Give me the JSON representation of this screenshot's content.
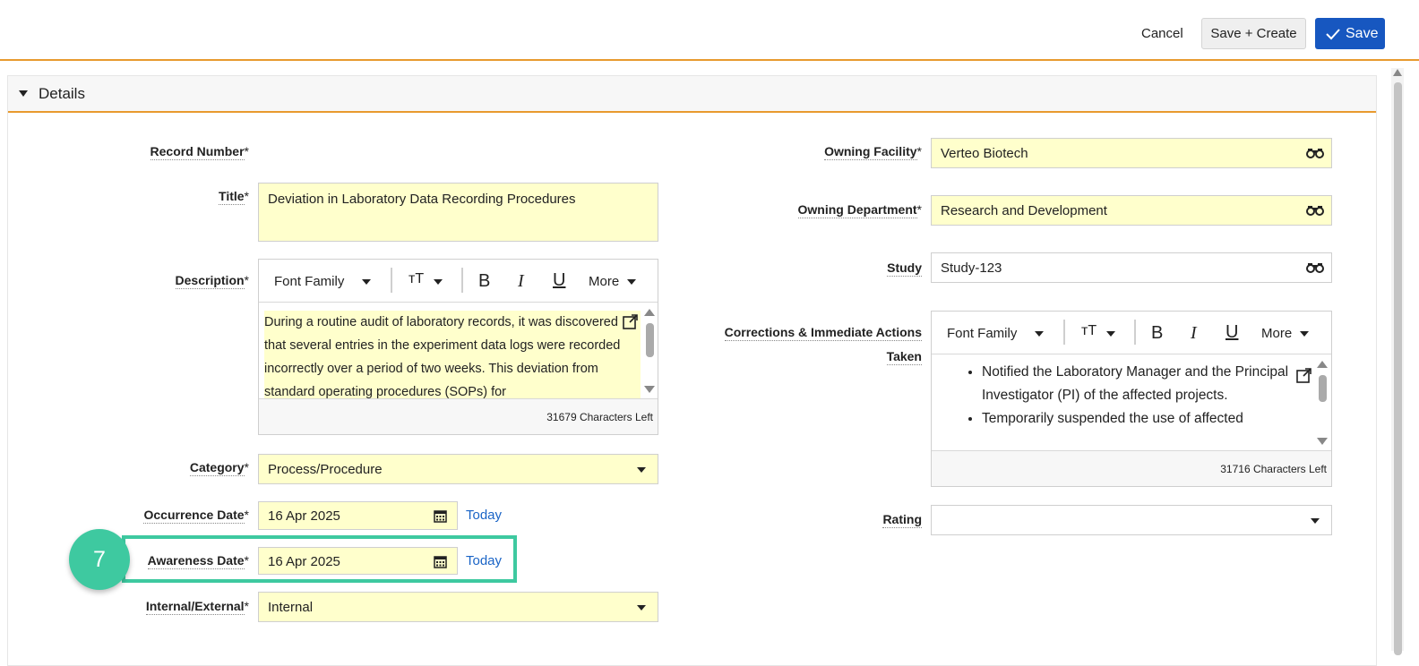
{
  "toolbar": {
    "cancel_label": "Cancel",
    "save_create_label": "Save + Create",
    "save_label": "Save"
  },
  "section": {
    "title": "Details"
  },
  "required_mark": "*",
  "left": {
    "record_number": {
      "label": "Record Number"
    },
    "title": {
      "label": "Title",
      "value": "Deviation in Laboratory Data Recording Procedures"
    },
    "description": {
      "label": "Description",
      "toolbar": {
        "font_family": "Font Family",
        "text_size": "тТ",
        "bold": "B",
        "italic": "I",
        "underline": "U",
        "more": "More"
      },
      "text": "During a routine audit of laboratory records, it was discovered that several entries in the experiment data logs were recorded incorrectly over a period of two weeks. This deviation from standard operating procedures (SOPs) for",
      "chars_left": "31679 Characters Left"
    },
    "category": {
      "label": "Category",
      "value": "Process/Procedure"
    },
    "occurrence_date": {
      "label": "Occurrence Date",
      "value": "16 Apr 2025",
      "today": "Today"
    },
    "awareness_date": {
      "label": "Awareness Date",
      "value": "16 Apr 2025",
      "today": "Today"
    },
    "internal_external": {
      "label": "Internal/External",
      "value": "Internal"
    }
  },
  "right": {
    "owning_facility": {
      "label": "Owning Facility",
      "value": "Verteo Biotech"
    },
    "owning_department": {
      "label": "Owning Department",
      "value": "Research and Development"
    },
    "study": {
      "label": "Study",
      "value": "Study-123"
    },
    "corrections": {
      "label_line1": "Corrections & Immediate Actions",
      "label_line2": "Taken",
      "toolbar": {
        "font_family": "Font Family",
        "text_size": "тТ",
        "bold": "B",
        "italic": "I",
        "underline": "U",
        "more": "More"
      },
      "bullets": [
        "Notified the Laboratory Manager and the Principal Investigator (PI) of the affected projects.",
        "Temporarily suspended the use of affected"
      ],
      "chars_left": "31716 Characters Left"
    },
    "rating": {
      "label": "Rating",
      "value": ""
    }
  },
  "tutorial": {
    "step_number": "7"
  },
  "colors": {
    "accent_orange": "#e89a2e",
    "primary_blue": "#1757c0",
    "field_yellow": "#ffffcc",
    "highlight_green": "#3ec9a0",
    "link_blue": "#1a64c6"
  }
}
